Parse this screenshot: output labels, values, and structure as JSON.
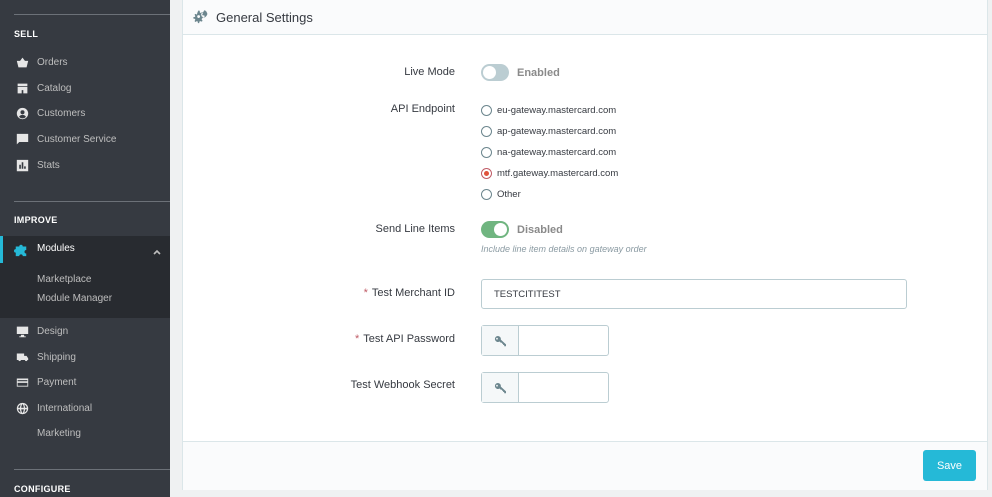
{
  "sidebar": {
    "sections": {
      "sell": "SELL",
      "improve": "IMPROVE",
      "configure": "CONFIGURE"
    },
    "sell_items": [
      {
        "label": "Orders",
        "icon": "basket-icon"
      },
      {
        "label": "Catalog",
        "icon": "store-icon"
      },
      {
        "label": "Customers",
        "icon": "user-circle-icon"
      },
      {
        "label": "Customer Service",
        "icon": "chat-icon"
      },
      {
        "label": "Stats",
        "icon": "bar-chart-icon"
      }
    ],
    "active_item": {
      "label": "Modules",
      "icon": "puzzle-icon"
    },
    "sub_items": [
      {
        "label": "Marketplace"
      },
      {
        "label": "Module Manager"
      }
    ],
    "improve_items": [
      {
        "label": "Design",
        "icon": "monitor-icon"
      },
      {
        "label": "Shipping",
        "icon": "truck-icon"
      },
      {
        "label": "Payment",
        "icon": "credit-card-icon"
      },
      {
        "label": "International",
        "icon": "globe-icon"
      },
      {
        "label": "Marketing",
        "icon": ""
      }
    ],
    "accent_color": "#25b9d7",
    "background_color": "#363a41"
  },
  "panel": {
    "title": "General Settings",
    "icon": "cogs-icon",
    "live_mode": {
      "label": "Live Mode",
      "state": "Enabled",
      "checked": false
    },
    "api_endpoint": {
      "label": "API Endpoint",
      "options": [
        {
          "label": "eu-gateway.mastercard.com",
          "checked": false
        },
        {
          "label": "ap-gateway.mastercard.com",
          "checked": false
        },
        {
          "label": "na-gateway.mastercard.com",
          "checked": false
        },
        {
          "label": "mtf.gateway.mastercard.com",
          "checked": true
        },
        {
          "label": "Other",
          "checked": false
        }
      ]
    },
    "send_line_items": {
      "label": "Send Line Items",
      "state": "Disabled",
      "checked": true,
      "help": "Include line item details on gateway order"
    },
    "merchant_id": {
      "required_mark": "*",
      "label": "Test Merchant ID",
      "value": "TESTCITITEST"
    },
    "api_password": {
      "required_mark": "*",
      "label": "Test API Password",
      "value": "",
      "icon": "key-icon"
    },
    "webhook_secret": {
      "label": "Test Webhook Secret",
      "value": "",
      "icon": "key-icon"
    },
    "save_label": "Save",
    "save_color": "#25b9d7"
  }
}
